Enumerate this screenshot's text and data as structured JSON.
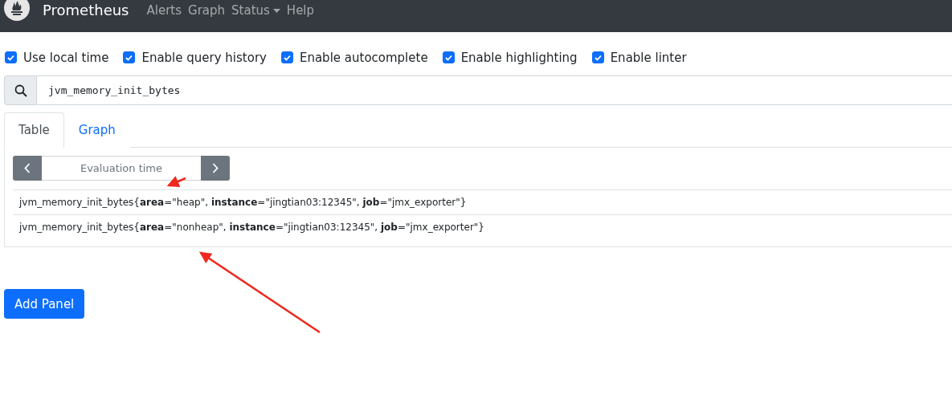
{
  "navbar": {
    "brand": "Prometheus",
    "links": [
      {
        "label": "Alerts",
        "kind": "link"
      },
      {
        "label": "Graph",
        "kind": "link"
      },
      {
        "label": "Status",
        "kind": "dropdown"
      },
      {
        "label": "Help",
        "kind": "link"
      }
    ]
  },
  "options": [
    {
      "label": "Use local time",
      "checked": true
    },
    {
      "label": "Enable query history",
      "checked": true
    },
    {
      "label": "Enable autocomplete",
      "checked": true
    },
    {
      "label": "Enable highlighting",
      "checked": true
    },
    {
      "label": "Enable linter",
      "checked": true
    }
  ],
  "query": {
    "value": "jvm_memory_init_bytes"
  },
  "tabs": [
    {
      "label": "Table",
      "selected": true
    },
    {
      "label": "Graph",
      "selected": false
    }
  ],
  "evaluation_time": {
    "placeholder": "Evaluation time"
  },
  "results": [
    "jvm_memory_init_bytes{**area**=\"heap\", **instance**=\"jingtian03:12345\", **job**=\"jmx_exporter\"}",
    "jvm_memory_init_bytes{**area**=\"nonheap\", **instance**=\"jingtian03:12345\", **job**=\"jmx_exporter\"}"
  ],
  "add_panel": {
    "label": "Add Panel"
  }
}
